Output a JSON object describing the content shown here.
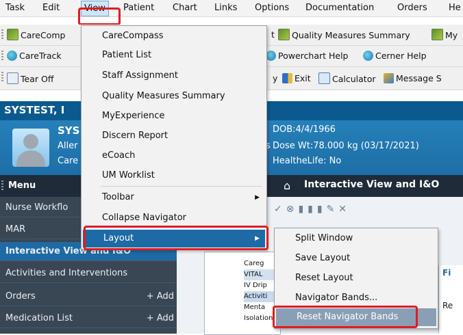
{
  "menubar": {
    "items": [
      "Task",
      "Edit",
      "View",
      "Patient",
      "Chart",
      "Links",
      "Options",
      "Documentation",
      "Orders",
      "He"
    ]
  },
  "toolbar1": {
    "carecompass": "CareComp",
    "after_menu": "t",
    "quality_measures": "Quality Measures Summary",
    "my": "My"
  },
  "toolbar2": {
    "caretrack": "CareTrack",
    "powerchart_help": "Powerchart Help",
    "cerner_help": "Cerner Help"
  },
  "toolbar3": {
    "tear_off": "Tear Off",
    "y_fragment": "y",
    "exit": "Exit",
    "calculator": "Calculator",
    "message": "Message S"
  },
  "patient": {
    "name_fragment": "SYSTEST, I",
    "sys_fragment": "SYS",
    "aller_fragment": "Aller",
    "care_fragment": "Care",
    "dob": "DOB:4/4/1966",
    "dose_wt": "Dose Wt:78.000 kg (03/17/2021)",
    "healthelife": "HealtheLife: No",
    "dose_prefix": "s"
  },
  "nav": {
    "header": "Menu",
    "items": [
      {
        "label": "Nurse Workflo"
      },
      {
        "label": "MAR"
      },
      {
        "label": "Interactive View and I&O"
      },
      {
        "label": "Activities and Interventions"
      },
      {
        "label": "Orders",
        "add": "+ Add"
      },
      {
        "label": "Medication List",
        "add": "+ Add"
      }
    ]
  },
  "main": {
    "title": "Interactive View and I&O",
    "icons": "✓⊗▮▮▮✎✕",
    "list_rows": [
      "Careg",
      "VITAL",
      "IV Drip",
      "Activiti",
      "Menta",
      "Isolation"
    ],
    "right_letter": "Fi",
    "right_letter2": "Re"
  },
  "view_menu": {
    "items": [
      "CareCompass",
      "Patient List",
      "Staff Assignment",
      "Quality Measures Summary",
      "MyExperience",
      "Discern Report",
      "eCoach",
      "UM Worklist",
      "Toolbar",
      "Collapse Navigator",
      "Layout"
    ]
  },
  "layout_menu": {
    "items": [
      "Split Window",
      "Save Layout",
      "Reset Layout",
      "Navigator Bands...",
      "Reset Navigator Bands"
    ]
  },
  "colors": {
    "highlight": "#1e6aa4",
    "red_callout": "#e11b22",
    "banner": "#1d6ea6"
  }
}
